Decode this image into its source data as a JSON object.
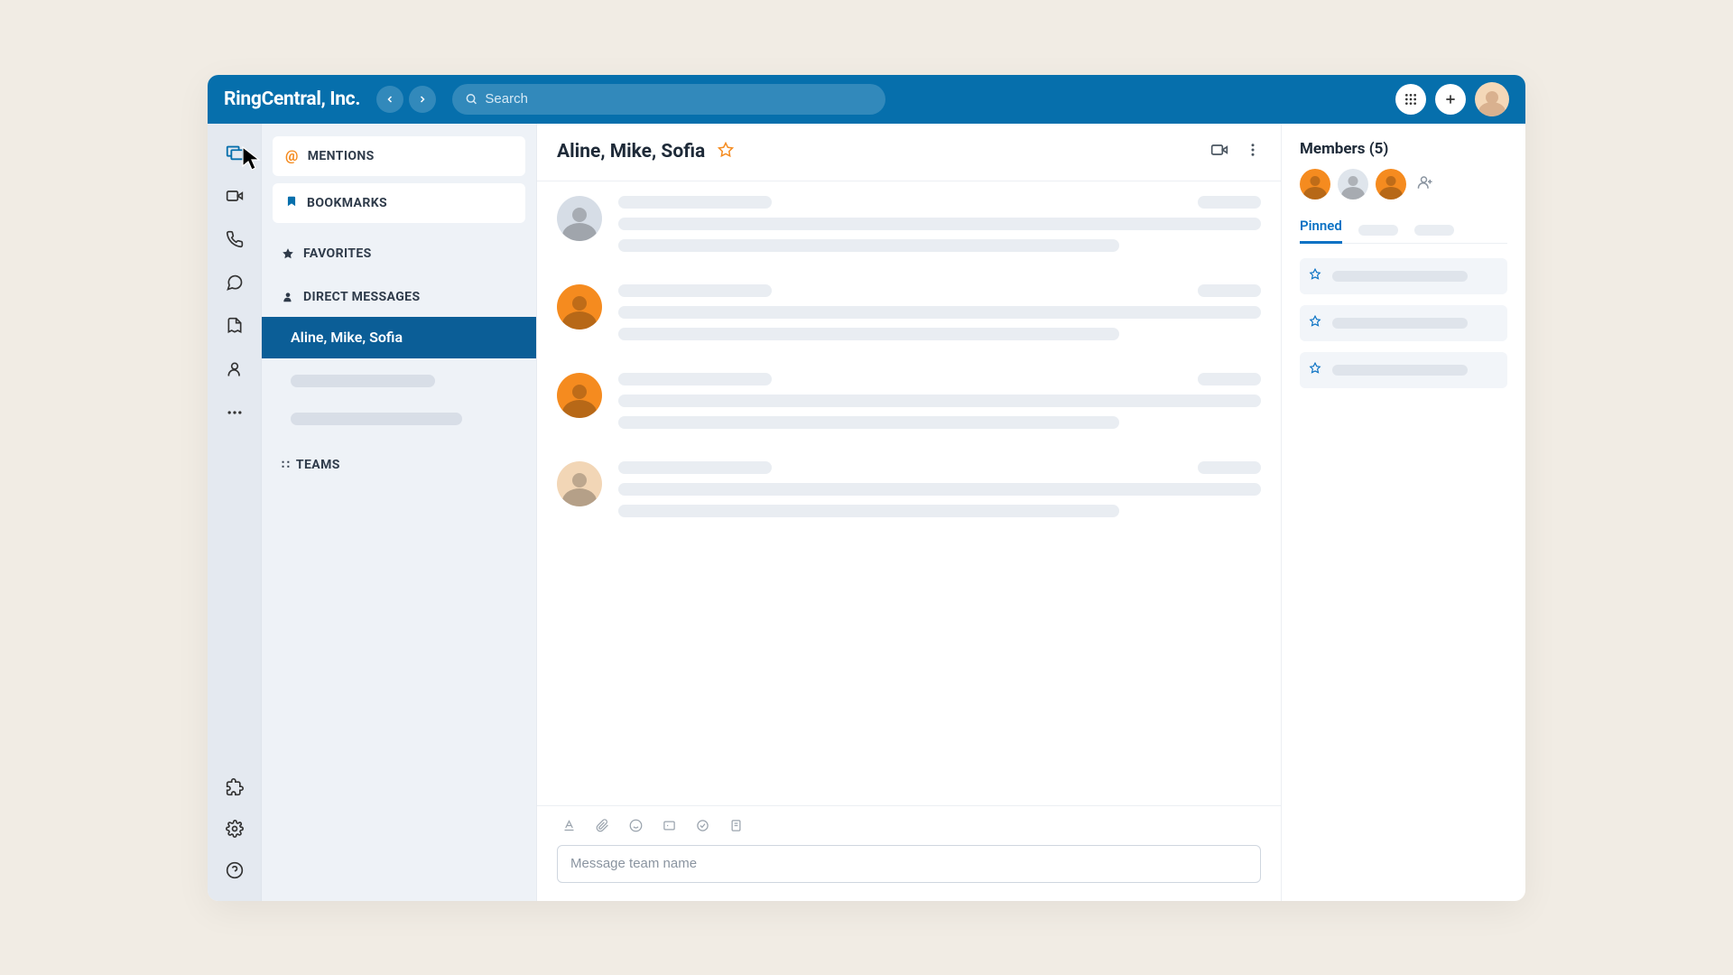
{
  "header": {
    "brand": "RingCentral, Inc.",
    "search_placeholder": "Search"
  },
  "rail": {
    "items": [
      "message",
      "video",
      "phone",
      "chat",
      "notes",
      "contacts"
    ],
    "more": "more",
    "bottom": [
      "apps",
      "settings",
      "help"
    ]
  },
  "sidebar": {
    "mentions_label": "MENTIONS",
    "bookmarks_label": "BOOKMARKS",
    "favorites_label": "FAVORITES",
    "direct_messages_label": "DIRECT MESSAGES",
    "teams_label": "TEAMS",
    "dm_items": [
      {
        "label": "Aline, Mike, Sofia",
        "active": true
      }
    ]
  },
  "conversation": {
    "title": "Aline, Mike, Sofia",
    "composer_placeholder": "Message team name"
  },
  "right_panel": {
    "members_title": "Members (5)",
    "tab_pinned": "Pinned"
  }
}
